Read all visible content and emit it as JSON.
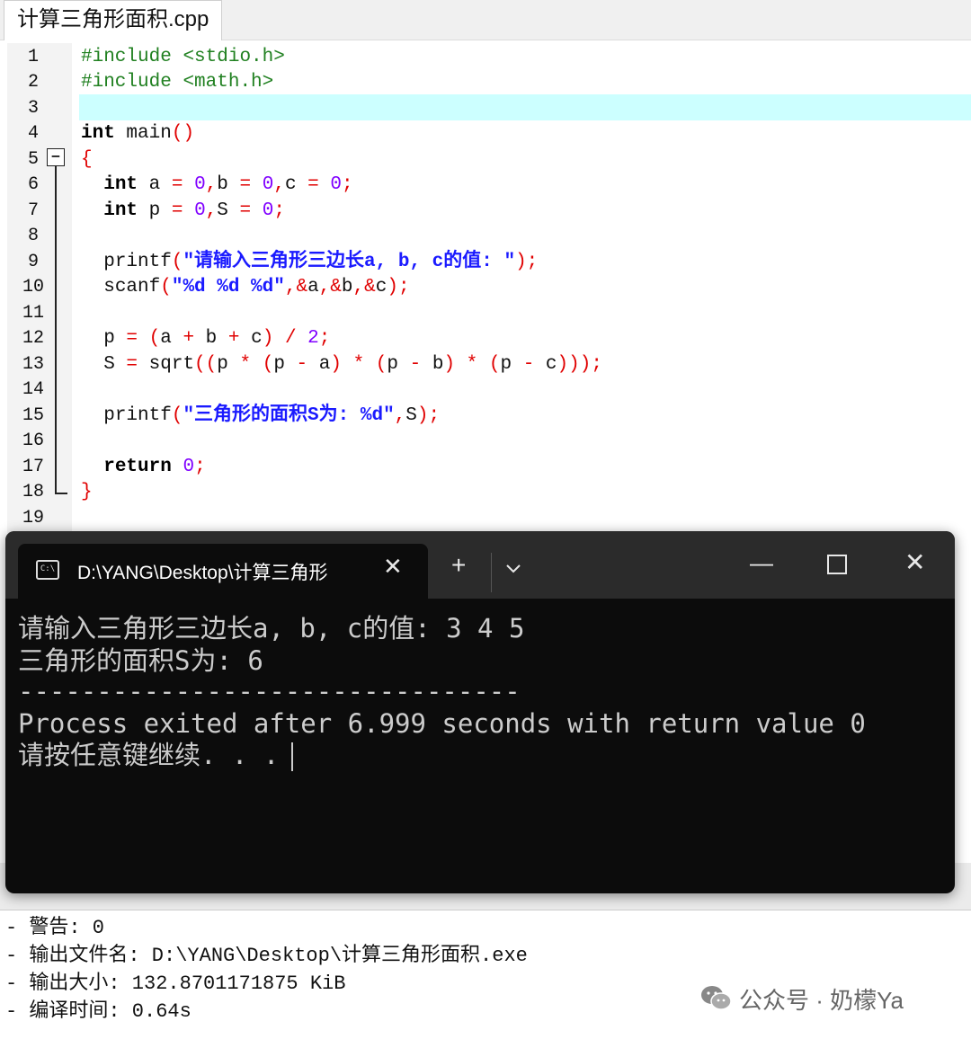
{
  "editor": {
    "file_tab": "计算三角形面积.cpp",
    "line_numbers": [
      "1",
      "2",
      "3",
      "4",
      "5",
      "6",
      "7",
      "8",
      "9",
      "10",
      "11",
      "12",
      "13",
      "14",
      "15",
      "16",
      "17",
      "18",
      "19"
    ],
    "fold_toggle": "−",
    "code": {
      "l1_directive": "#include",
      "l1_header": "<stdio.h>",
      "l2_directive": "#include",
      "l2_header": "<math.h>",
      "l4_type": "int",
      "l4_name": "main",
      "l4_parens": "()",
      "l5_brace": "{",
      "l6_type": "int",
      "l7_type": "int",
      "l9_call": "printf",
      "l9_string": "\"请输入三角形三边长a, b, c的值: \"",
      "l10_call": "scanf",
      "l10_string": "\"%d %d %d\"",
      "l15_call": "printf",
      "l15_string": "\"三角形的面积S为: %d\"",
      "l17_keyword": "return",
      "l17_value": "0",
      "l18_brace": "}"
    }
  },
  "terminal": {
    "tab_title": "D:\\YANG\\Desktop\\计算三角形",
    "tab_close": "✕",
    "new_tab": "+",
    "dropdown": "⌄",
    "minimize": "—",
    "close": "✕",
    "icon_text": "C:\\",
    "lines": [
      "请输入三角形三边长a, b, c的值: 3 4 5",
      "三角形的面积S为: 6",
      "--------------------------------",
      "Process exited after 6.999 seconds with return value 0",
      "请按任意键继续. . ."
    ]
  },
  "compile_log": {
    "lines": [
      "- 警告: 0",
      "- 输出文件名: D:\\YANG\\Desktop\\计算三角形面积.exe",
      "- 输出大小: 132.8701171875 KiB",
      "- 编译时间: 0.64s"
    ]
  },
  "watermark": "公众号 · 奶檬Ya",
  "icons": [
    "file-tab",
    "fold-toggle-icon",
    "terminal-app-icon",
    "close-icon",
    "plus-icon",
    "chevron-down-icon",
    "minimize-icon",
    "maximize-icon",
    "wechat-icon"
  ]
}
